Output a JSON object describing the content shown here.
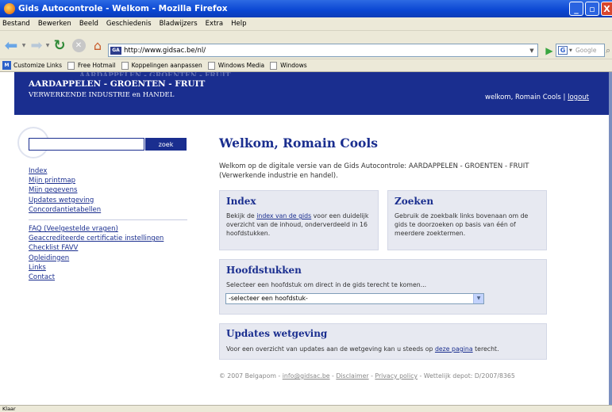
{
  "window": {
    "title": "Gids Autocontrole - Welkom - Mozilla Firefox"
  },
  "menu": [
    "Bestand",
    "Bewerken",
    "Beeld",
    "Geschiedenis",
    "Bladwijzers",
    "Extra",
    "Help"
  ],
  "navbar": {
    "url": "http://www.gidsac.be/nl/",
    "favicon_label": "GA",
    "search_engine": "G",
    "search_placeholder": "Google"
  },
  "bookmarks": [
    "Customize Links",
    "Free Hotmail",
    "Koppelingen aanpassen",
    "Windows Media",
    "Windows"
  ],
  "header": {
    "title": "AARDAPPELEN - GROENTEN - FRUIT",
    "subtitle": "VERWERKENDE INDUSTRIE en HANDEL",
    "welcome": "welkom, Romain Cools |",
    "logout": "logout"
  },
  "search": {
    "button": "zoek",
    "value": ""
  },
  "sidenav": {
    "group1": [
      "Index",
      "Mijn printmap",
      "Mijn gegevens",
      "Updates wetgeving",
      "Concordantietabellen"
    ],
    "group2": [
      "FAQ (Veelgestelde vragen)",
      "Geaccrediteerde certificatie instellingen",
      "Checklist FAVV",
      "Opleidingen",
      "Links",
      "Contact"
    ]
  },
  "main": {
    "title": "Welkom, Romain Cools",
    "intro": "Welkom op de digitale versie van de Gids Autocontrole: AARDAPPELEN - GROENTEN - FRUIT (Verwerkende industrie en handel)."
  },
  "index_box": {
    "title": "Index",
    "text_before": "Bekijk de ",
    "link": "index van de gids",
    "text_after": " voor een duidelijk overzicht van de inhoud, onderverdeeld in 16 hoofdstukken."
  },
  "zoeken_box": {
    "title": "Zoeken",
    "text": "Gebruik de zoekbalk links bovenaan om de gids te doorzoeken op basis van één of meerdere zoektermen."
  },
  "hoofd_box": {
    "title": "Hoofdstukken",
    "text": "Selecteer een hoofdstuk om direct in de gids terecht te komen...",
    "select_value": "-selecteer een hoofdstuk-"
  },
  "updates_box": {
    "title": "Updates wetgeving",
    "text_before": "Voor een overzicht van updates aan de wetgeving kan u steeds op ",
    "link": "deze pagina",
    "text_after": " terecht."
  },
  "footer": {
    "copyright": "© 2007 Belgapom - ",
    "email": "info@gidsac.be",
    "sep1": " - ",
    "disclaimer": "Disclaimer",
    "sep2": " - ",
    "privacy": "Privacy policy",
    "legal": " - Wettelijk depot: D/2007/8365"
  },
  "status": "Klaar"
}
